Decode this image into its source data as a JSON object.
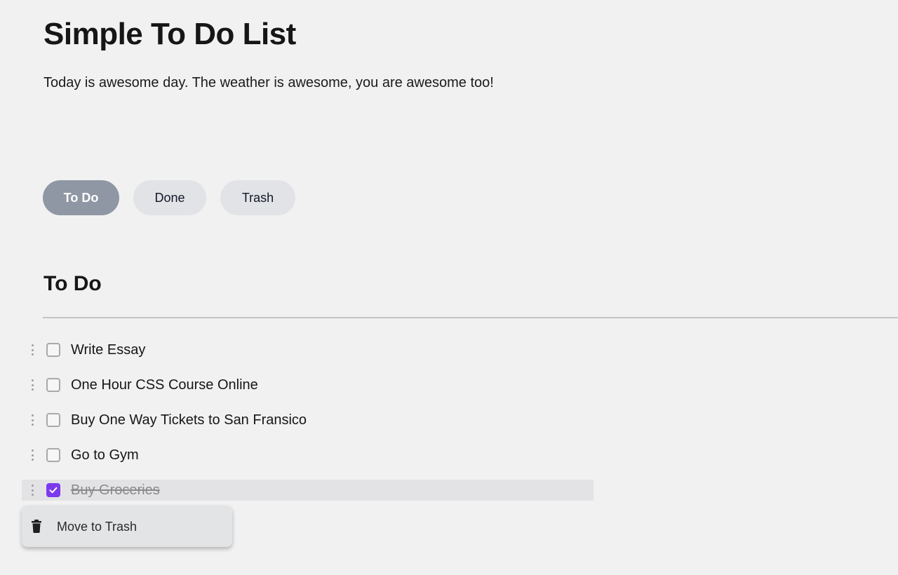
{
  "header": {
    "title": "Simple To Do List",
    "subtitle": "Today is awesome day. The weather is awesome, you are awesome too!"
  },
  "tabs": [
    {
      "label": "To Do",
      "active": true
    },
    {
      "label": "Done",
      "active": false
    },
    {
      "label": "Trash",
      "active": false
    }
  ],
  "section": {
    "title": "To Do"
  },
  "tasks": [
    {
      "label": "Write Essay",
      "checked": false
    },
    {
      "label": "One Hour CSS Course Online",
      "checked": false
    },
    {
      "label": "Buy One Way Tickets to San Fransico",
      "checked": false
    },
    {
      "label": "Go to Gym",
      "checked": false
    },
    {
      "label": "Buy Groceries",
      "checked": true
    }
  ],
  "context_menu": {
    "items": [
      {
        "label": "Move to Trash",
        "icon": "trash-icon"
      }
    ]
  },
  "colors": {
    "background": "#f1f1f1",
    "active_tab": "#8f97a4",
    "inactive_tab": "#e2e3e6",
    "checkbox_checked": "#7c3aed",
    "completed_text": "#8a8a8a"
  }
}
